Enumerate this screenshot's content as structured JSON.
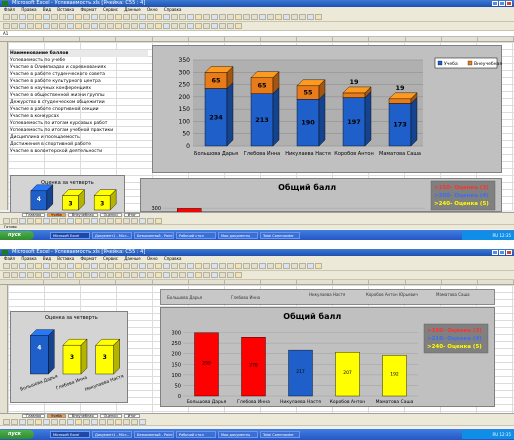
{
  "app": {
    "title_top": "Microsoft Excel - Успеваемость.xls [Ячейка: С55 : 4]",
    "title_bottom": "Microsoft Excel - Успеваемость.xls [Ячейка: С55 : 4]",
    "menu": [
      "Файл",
      "Правка",
      "Вид",
      "Вставка",
      "Формат",
      "Сервис",
      "Данные",
      "Окно",
      "Справка"
    ],
    "cell_ref": "A1"
  },
  "criteria_list": {
    "header": "Наименование баллов",
    "items": [
      "Успеваемость по учебе",
      "Участие в Олимпиадах и соревнованиях",
      "Участие в работе студенческого совета",
      "Участие в работе культурного центра",
      "Участие в научных конференциях",
      "Участие в общественной жизни группы",
      "Дежурство в студенческом общежитии",
      "Участие в работе спортивной секции",
      "Участие в конкурсах",
      "Успеваемость по итогам курсовых работ",
      "Успеваемость по итогам учебной практики",
      "Дисциплина и посещаемость",
      "Достижения в спортивной работе",
      "Участие в волонтерской деятельности"
    ]
  },
  "stacked_chart": {
    "legend": [
      "Учеба",
      "Внеучебная"
    ],
    "y_ticks": [
      "350",
      "300",
      "250",
      "200",
      "150",
      "100",
      "50",
      "0"
    ]
  },
  "total_chart": {
    "title": "Общий балл",
    "legend_top": [
      ">150- Оценка (3)",
      ">200- Оценка (4)",
      ">240- Оценка (5)"
    ],
    "legend_bottom": [
      ">150- Оценка (3)",
      ">210- Оценка (4)",
      ">240- Оценка (5)"
    ],
    "y_ticks": [
      "300",
      "250",
      "200",
      "150",
      "100",
      "50",
      "0"
    ]
  },
  "quarter_chart": {
    "title": "Оценка за четверть"
  },
  "chart_data": [
    {
      "type": "bar",
      "stacked": true,
      "categories": [
        "Большова Дарья",
        "Глебова Инна",
        "Никулаева Настя",
        "Коробов Антон",
        "Маматова Саша"
      ],
      "series": [
        {
          "name": "Учеба",
          "values": [
            234,
            213,
            190,
            197,
            173
          ],
          "color": "#1f5fc9"
        },
        {
          "name": "Внеучебная",
          "values": [
            65,
            65,
            55,
            19,
            19
          ],
          "color": "#e87b1a"
        }
      ],
      "ylim": [
        0,
        350
      ],
      "legend_position": "top-right",
      "grid": true
    },
    {
      "type": "bar",
      "title": "Общий балл",
      "categories": [
        "Большова Дарья",
        "Глебова Инна",
        "Никулаева Настя",
        "Коробов Антон",
        "Маматова Саша"
      ],
      "values": [
        299,
        278,
        217,
        207,
        192
      ],
      "colors": [
        "#ff0000",
        "#ff0000",
        "#1f5fc9",
        "#ffff00",
        "#ffff00"
      ],
      "ylim": [
        0,
        350
      ],
      "grid": true
    },
    {
      "type": "bar",
      "title": "Оценка за четверть",
      "categories": [
        "Большова Дарья",
        "Глебова Инна",
        "Никулаева Настя"
      ],
      "values": [
        4,
        3,
        3
      ],
      "colors": [
        "#1f5fc9",
        "#ffff00",
        "#ffff00"
      ],
      "ylim": [
        0,
        5
      ]
    }
  ],
  "column_headers_row": [
    "Большова Дарья",
    "Глебова Инна",
    "Никулаева Настя",
    "Коробов Антон Юрьевич",
    "Маматова Саша"
  ],
  "sheet_tabs": [
    "Главная",
    "Учеба",
    "Внеучебная",
    "Оценки",
    "Итог"
  ],
  "status": {
    "text": "Готово"
  },
  "taskbar": {
    "start_label": "пуск",
    "items": [
      "Microsoft Excel",
      "Документ1 - Micr...",
      "Безымянный - Paint",
      "Рабочий стол",
      "Мои документы",
      "Total Commander"
    ],
    "clock": "RU 12:35"
  },
  "colors": {
    "blue": "#1f5fc9",
    "orange": "#e87b1a",
    "red": "#ff0000",
    "yellow": "#ffff00",
    "plot_bg": "#c0c0c0"
  }
}
